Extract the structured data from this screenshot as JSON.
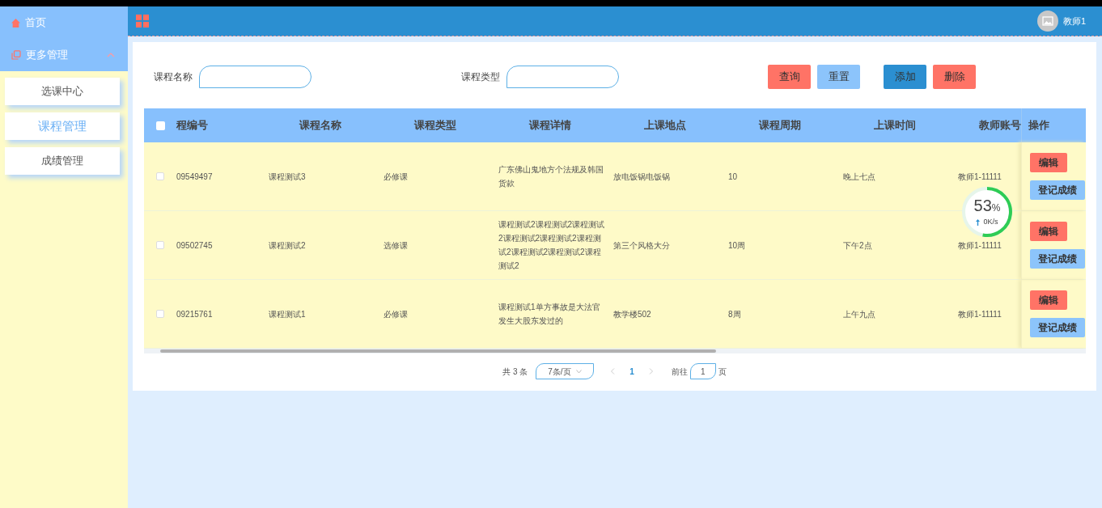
{
  "sidebar": {
    "home": "首页",
    "group": {
      "label": "更多管理",
      "expanded": true
    },
    "items": [
      {
        "label": "选课中心",
        "selected": false
      },
      {
        "label": "课程管理",
        "selected": true
      },
      {
        "label": "成绩管理",
        "selected": false
      }
    ]
  },
  "header": {
    "user": "教师1"
  },
  "filters": [
    {
      "label": "课程名称"
    },
    {
      "label": "课程类型"
    }
  ],
  "buttons": [
    {
      "label": "查询",
      "kind": "danger"
    },
    {
      "label": "重置",
      "kind": "light"
    },
    {
      "label": "添加",
      "kind": "primary"
    },
    {
      "label": "删除",
      "kind": "danger"
    }
  ],
  "table": {
    "all_checked": false,
    "columns": [
      "程编号",
      "课程名称",
      "课程类型",
      "课程详情",
      "上课地点",
      "课程周期",
      "上课时间",
      "教师账号"
    ],
    "action_column": "操作",
    "rows": [
      {
        "checked": false,
        "actions": [
          "编辑",
          "登记成绩"
        ],
        "cells": [
          "09549497",
          "课程测试3",
          "必修课",
          "广东佛山鬼地方个法规及韩国货款",
          "放电饭锅电饭锅",
          "10",
          "晚上七点",
          "教师1-11111"
        ]
      },
      {
        "checked": false,
        "actions": [
          "编辑",
          "登记成绩"
        ],
        "cells": [
          "09502745",
          "课程测试2",
          "选修课",
          "课程测试2课程测试2课程测试2课程测试2课程测试2课程测试2课程测试2课程测试2课程测试2",
          "第三个风格大分",
          "10周",
          "下午2点",
          "教师1-11111"
        ]
      },
      {
        "checked": false,
        "actions": [
          "编辑",
          "登记成绩"
        ],
        "cells": [
          "09215761",
          "课程测试1",
          "必修课",
          "课程测试1单方事故是大法官发生大股东发过的",
          "教学楼502",
          "8周",
          "上午九点",
          "教师1-11111"
        ]
      }
    ]
  },
  "pagination": {
    "total": "共 3 条",
    "page_size": "7条/页",
    "pages": [
      {
        "label": "1",
        "selected": true
      }
    ],
    "goto_label": "前往",
    "goto_value": "1",
    "goto_suffix": "页"
  },
  "overlay": {
    "percent": "53",
    "unit": "%",
    "speed": "0K/s"
  }
}
